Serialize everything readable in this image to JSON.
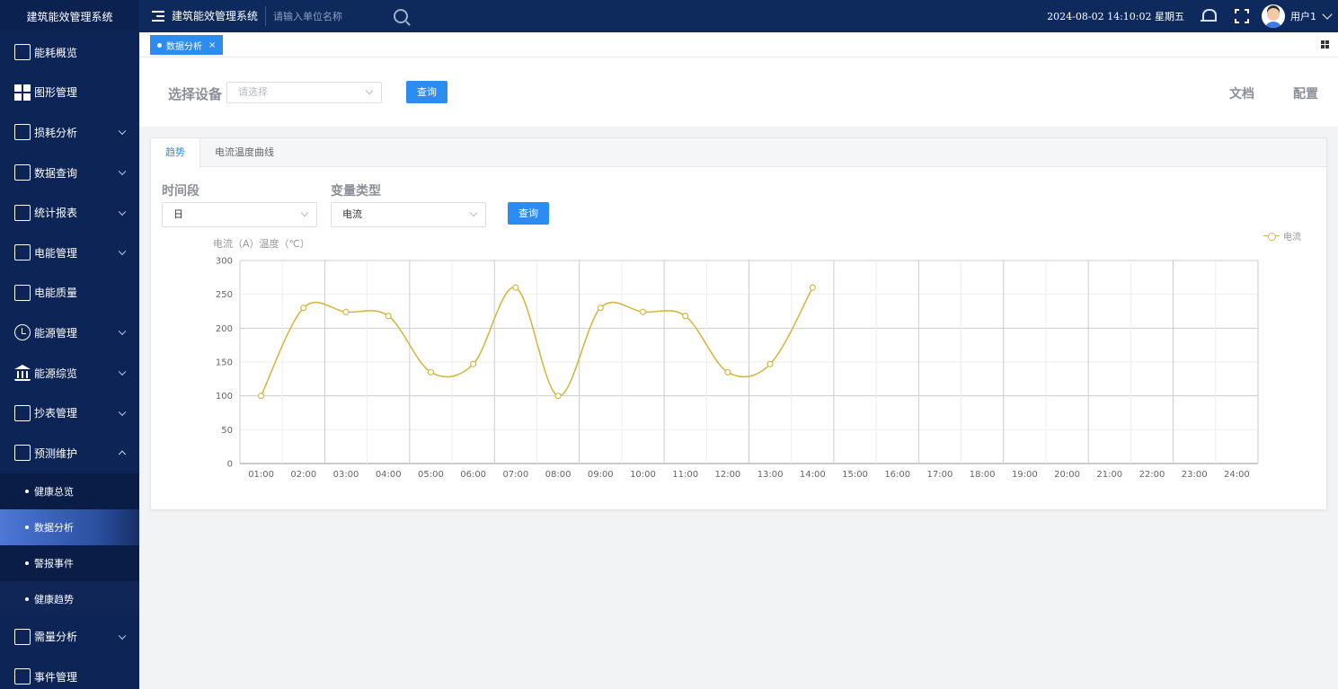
{
  "app": {
    "brand": "建筑能效管理系统",
    "title": "建筑能效管理系统",
    "search_placeholder": "请输入单位名称",
    "datetime": "2024-08-02 14:10:02 星期五",
    "user": "用户1"
  },
  "sidebar": {
    "items": [
      {
        "label": "能耗概览",
        "icon": "monitor-search-icon"
      },
      {
        "label": "图形管理",
        "icon": "grid-icon"
      },
      {
        "label": "损耗分析",
        "icon": "monitor-search-icon"
      },
      {
        "label": "数据查询",
        "icon": "chart-monitor-icon"
      },
      {
        "label": "统计报表",
        "icon": "edit-doc-icon"
      },
      {
        "label": "电能管理",
        "icon": "power-icon"
      },
      {
        "label": "电能质量",
        "icon": "edit-doc-icon"
      },
      {
        "label": "能源管理",
        "icon": "clock-icon"
      },
      {
        "label": "能源综览",
        "icon": "bank-icon"
      },
      {
        "label": "抄表管理",
        "icon": "edit-doc-icon"
      },
      {
        "label": "预测维护",
        "icon": "chart-monitor-icon"
      },
      {
        "label": "需量分析",
        "icon": "chart-icon"
      },
      {
        "label": "事件管理",
        "icon": "chart-icon"
      }
    ],
    "sub_items": [
      "健康总览",
      "数据分析",
      "警报事件",
      "健康趋势"
    ]
  },
  "tabs": {
    "page_tab": "数据分析",
    "close": "×"
  },
  "filter": {
    "label": "选择设备",
    "select_placeholder": "请选择",
    "query": "查询",
    "doc": "文档",
    "config": "配置"
  },
  "card": {
    "tabs": [
      "趋势",
      "电流温度曲线"
    ],
    "period_label": "时间段",
    "period_value": "日",
    "var_label": "变量类型",
    "var_value": "电流",
    "query": "查询"
  },
  "chart_data": {
    "type": "line",
    "ylabel": "电流（A）温度（℃）",
    "ylim": [
      0,
      300
    ],
    "yticks": [
      0,
      50,
      100,
      150,
      200,
      250,
      300
    ],
    "categories": [
      "01:00",
      "02:00",
      "03:00",
      "04:00",
      "05:00",
      "06:00",
      "07:00",
      "08:00",
      "09:00",
      "10:00",
      "11:00",
      "12:00",
      "13:00",
      "14:00",
      "15:00",
      "16:00",
      "17:00",
      "18:00",
      "19:00",
      "20:00",
      "21:00",
      "22:00",
      "23:00",
      "24:00"
    ],
    "series": [
      {
        "name": "电流",
        "color": "#d4b843",
        "values": [
          100,
          230,
          224,
          218,
          135,
          147,
          260,
          100,
          230,
          224,
          218,
          135,
          147,
          260
        ]
      }
    ],
    "legend": "top-right",
    "grid": true
  }
}
